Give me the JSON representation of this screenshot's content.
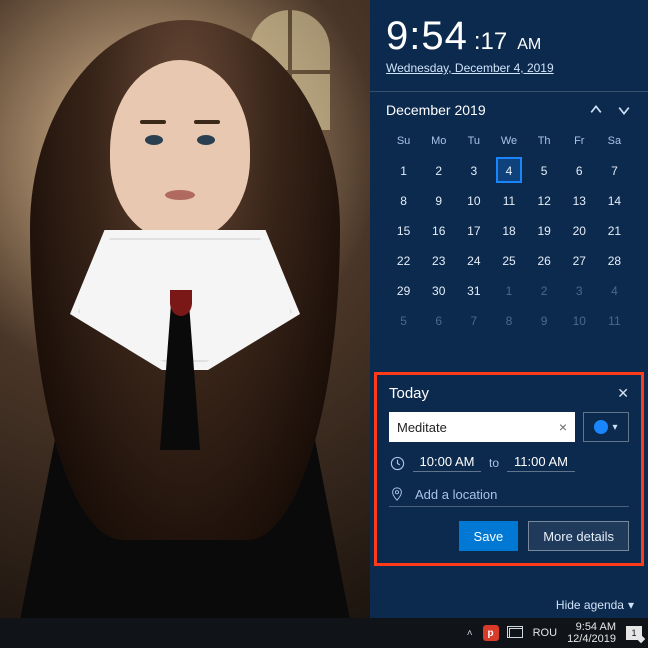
{
  "clock": {
    "hm": "9:54",
    "sec": ":17",
    "ampm": "AM",
    "date": "Wednesday, December 4, 2019"
  },
  "calendar": {
    "month_label": "December 2019",
    "dow": [
      "Su",
      "Mo",
      "Tu",
      "We",
      "Th",
      "Fr",
      "Sa"
    ],
    "weeks": [
      [
        {
          "n": "1"
        },
        {
          "n": "2"
        },
        {
          "n": "3"
        },
        {
          "n": "4",
          "today": true
        },
        {
          "n": "5"
        },
        {
          "n": "6"
        },
        {
          "n": "7"
        }
      ],
      [
        {
          "n": "8"
        },
        {
          "n": "9"
        },
        {
          "n": "10"
        },
        {
          "n": "11"
        },
        {
          "n": "12"
        },
        {
          "n": "13"
        },
        {
          "n": "14"
        }
      ],
      [
        {
          "n": "15"
        },
        {
          "n": "16"
        },
        {
          "n": "17"
        },
        {
          "n": "18"
        },
        {
          "n": "19"
        },
        {
          "n": "20"
        },
        {
          "n": "21"
        }
      ],
      [
        {
          "n": "22"
        },
        {
          "n": "23"
        },
        {
          "n": "24"
        },
        {
          "n": "25"
        },
        {
          "n": "26"
        },
        {
          "n": "27"
        },
        {
          "n": "28"
        }
      ],
      [
        {
          "n": "29"
        },
        {
          "n": "30"
        },
        {
          "n": "31"
        },
        {
          "n": "1",
          "dim": true
        },
        {
          "n": "2",
          "dim": true
        },
        {
          "n": "3",
          "dim": true
        },
        {
          "n": "4",
          "dim": true
        }
      ],
      [
        {
          "n": "5",
          "dim": true
        },
        {
          "n": "6",
          "dim": true
        },
        {
          "n": "7",
          "dim": true
        },
        {
          "n": "8",
          "dim": true
        },
        {
          "n": "9",
          "dim": true
        },
        {
          "n": "10",
          "dim": true
        },
        {
          "n": "11",
          "dim": true
        }
      ]
    ]
  },
  "agenda": {
    "header": "Today",
    "event_name": "Meditate",
    "clear_glyph": "×",
    "color": "#1986ff",
    "start": "10:00 AM",
    "to": "to",
    "end": "11:00 AM",
    "location_placeholder": "Add a location",
    "save": "Save",
    "more": "More details",
    "hide": "Hide agenda"
  },
  "taskbar": {
    "lang": "ROU",
    "time": "9:54 AM",
    "date": "12/4/2019",
    "notif_count": "1"
  }
}
